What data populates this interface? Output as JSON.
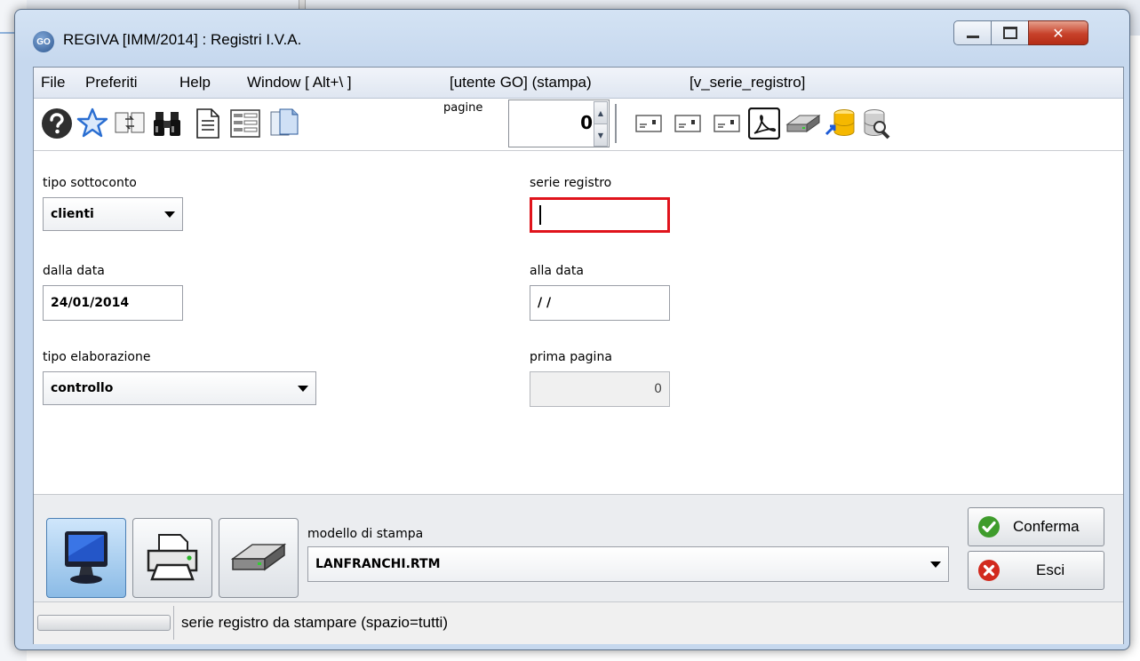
{
  "window": {
    "app_icon_text": "GO",
    "title": "REGIVA [IMM/2014] : Registri I.V.A.",
    "minimize_icon": "minimize-icon",
    "maximize_icon": "maximize-icon",
    "close_icon": "close-icon"
  },
  "menubar": {
    "items": [
      "File",
      "Preferiti",
      "Help",
      "Window [ Alt+\\ ]",
      "[utente GO] (stampa)",
      "[v_serie_registro]"
    ]
  },
  "toolbar": {
    "icons": [
      "help-icon",
      "favorite-star-icon",
      "swap-window-icon",
      "binoculars-icon",
      "document-icon",
      "form-icon",
      "copy-documents-icon"
    ],
    "pagine_label": "pagine",
    "pagine_value": "0",
    "right_icons": [
      "field-icon-1",
      "field-icon-2",
      "field-icon-3",
      "pdf-icon",
      "disk-drive-icon",
      "database-export-icon",
      "database-search-icon"
    ]
  },
  "form": {
    "tipo_sottoconto": {
      "label": "tipo sottoconto",
      "value": "clienti"
    },
    "serie_registro": {
      "label": "serie registro",
      "value": ""
    },
    "dalla_data": {
      "label": "dalla data",
      "value": "24/01/2014"
    },
    "alla_data": {
      "label": "alla data",
      "value": "/ /"
    },
    "tipo_elaborazione": {
      "label": "tipo elaborazione",
      "value": "controllo"
    },
    "prima_pagina": {
      "label": "prima pagina",
      "value": "0"
    }
  },
  "output": {
    "buttons": [
      "monitor-icon",
      "printer-icon",
      "disk-drive-icon"
    ],
    "modello_label": "modello di stampa",
    "modello_value": "LANFRANCHI.RTM",
    "confirm_label": "Conferma",
    "exit_label": "Esci"
  },
  "status": {
    "text": "serie registro da stampare (spazio=tutti)"
  },
  "colors": {
    "focus_border": "#e0141c",
    "title_bar": "#c6d8ee",
    "close_button": "#c7412a",
    "confirm_icon": "#3f9c2c",
    "exit_icon": "#d22a1e"
  }
}
